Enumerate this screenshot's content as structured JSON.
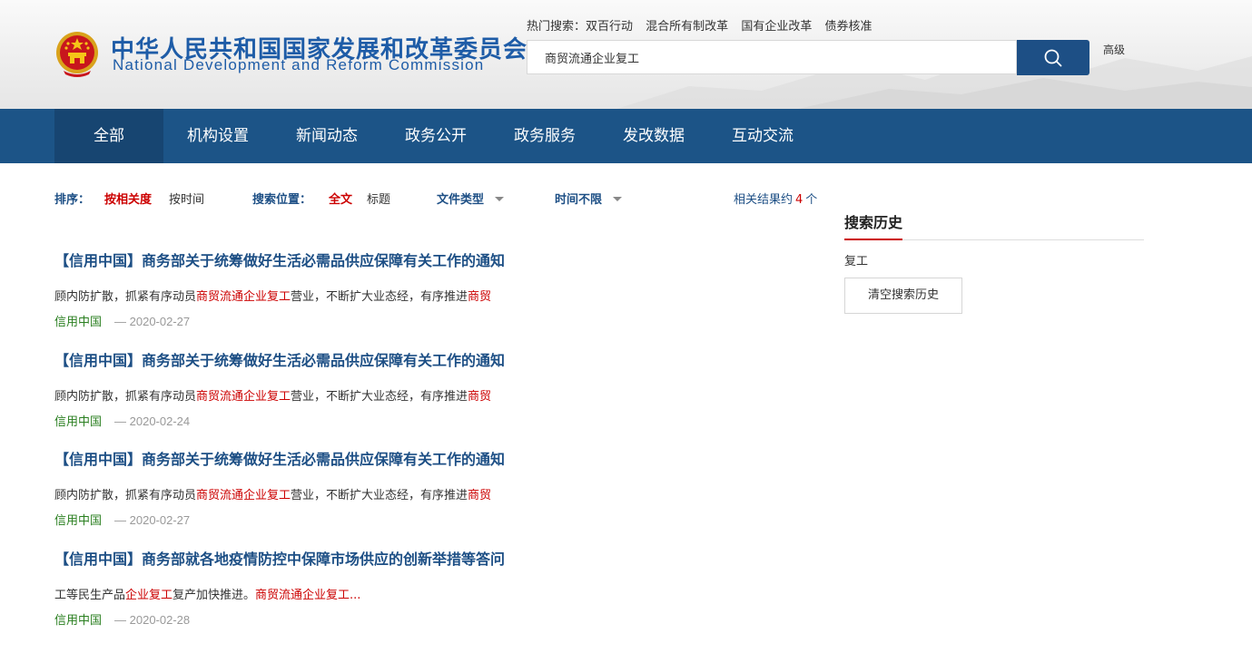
{
  "header": {
    "title_cn": "中华人民共和国国家发展和改革委员会",
    "title_en": "National Development and Reform Commission",
    "hot_label": "热门搜索：",
    "hot_items": [
      "双百行动",
      "混合所有制改革",
      "国有企业改革",
      "债券核准"
    ],
    "search_value": "商贸流通企业复工",
    "advanced_label": "高级",
    "search_icon": "search-icon",
    "emblem_icon": "national-emblem-icon"
  },
  "nav": [
    "全部",
    "机构设置",
    "新闻动态",
    "政务公开",
    "政务服务",
    "发改数据",
    "互动交流"
  ],
  "filters": {
    "sort_label": "排序：",
    "sort_relevance": "按相关度",
    "sort_time": "按时间",
    "position_label": "搜索位置：",
    "position_full": "全文",
    "position_title": "标题",
    "filetype_label": "文件类型",
    "time_label": "时间不限",
    "count_prefix": "相关结果约",
    "count_value": "4",
    "count_suffix": "个"
  },
  "results": [
    {
      "title": "【信用中国】商务部关于统筹做好生活必需品供应保障有关工作的通知",
      "snippet_a": "顾内防扩散，抓紧有序动员",
      "snippet_hl1": "商贸流通企业复工",
      "snippet_b": "营业，不断扩大业态经，有序推进",
      "snippet_hl2": "商贸",
      "source": "信用中国",
      "date": "— 2020-02-27"
    },
    {
      "title": "【信用中国】商务部关于统筹做好生活必需品供应保障有关工作的通知",
      "snippet_a": "顾内防扩散，抓紧有序动员",
      "snippet_hl1": "商贸流通企业复工",
      "snippet_b": "营业，不断扩大业态经，有序推进",
      "snippet_hl2": "商贸",
      "source": "信用中国",
      "date": "— 2020-02-24"
    },
    {
      "title": "【信用中国】商务部关于统筹做好生活必需品供应保障有关工作的通知",
      "snippet_a": "顾内防扩散，抓紧有序动员",
      "snippet_hl1": "商贸流通企业复工",
      "snippet_b": "营业，不断扩大业态经，有序推进",
      "snippet_hl2": "商贸",
      "source": "信用中国",
      "date": "— 2020-02-27"
    },
    {
      "title": "【信用中国】商务部就各地疫情防控中保障市场供应的创新举措等答问",
      "snippet_a": "工等民生产品",
      "snippet_hl1": "企业复工",
      "snippet_b": "复产加快推进。",
      "snippet_hl2": "商贸流通企业复工...",
      "source": "信用中国",
      "date": "— 2020-02-28"
    }
  ],
  "sidebar": {
    "title": "搜索历史",
    "history": [
      "复工"
    ],
    "clear_label": "清空搜索历史"
  },
  "colors": {
    "primary_blue": "#1c5487",
    "nav_active": "#174571",
    "highlight_red": "#cc0000",
    "source_green": "#2a7f20"
  }
}
